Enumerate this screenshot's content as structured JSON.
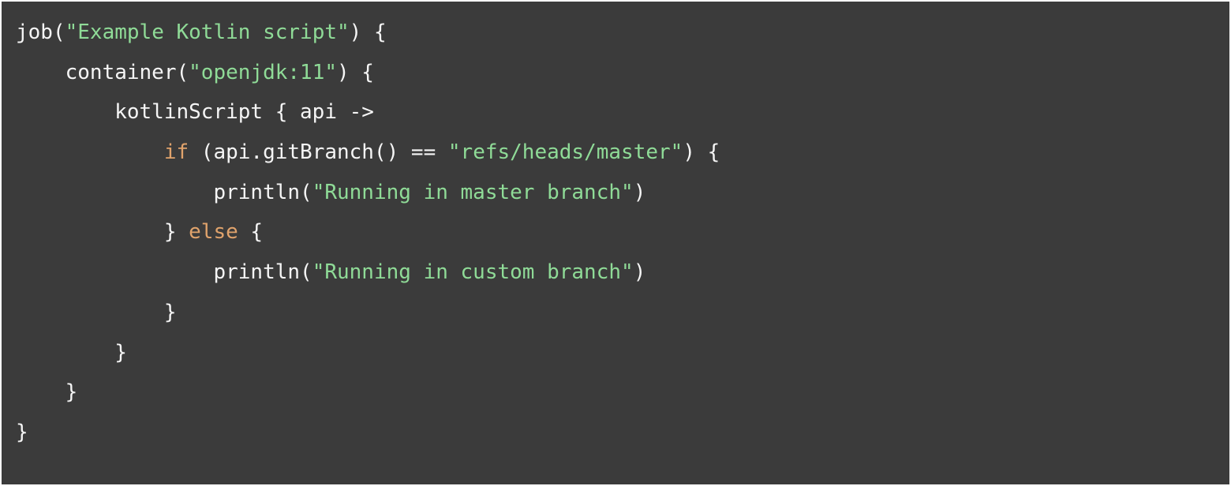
{
  "code": {
    "line1_a": "job(",
    "line1_str": "\"Example Kotlin script\"",
    "line1_b": ") {",
    "line2_a": "    container(",
    "line2_str": "\"openjdk:11\"",
    "line2_b": ") {",
    "line3": "        kotlinScript { api ->",
    "line4_indent": "            ",
    "line4_kw": "if",
    "line4_a": " (api.gitBranch() == ",
    "line4_str": "\"refs/heads/master\"",
    "line4_b": ") {",
    "line5_a": "                println(",
    "line5_str": "\"Running in master branch\"",
    "line5_b": ")",
    "line6_a": "            } ",
    "line6_kw": "else",
    "line6_b": " {",
    "line7_a": "                println(",
    "line7_str": "\"Running in custom branch\"",
    "line7_b": ")",
    "line8": "            }",
    "line9": "        }",
    "line10": "    }",
    "line11": "}"
  }
}
